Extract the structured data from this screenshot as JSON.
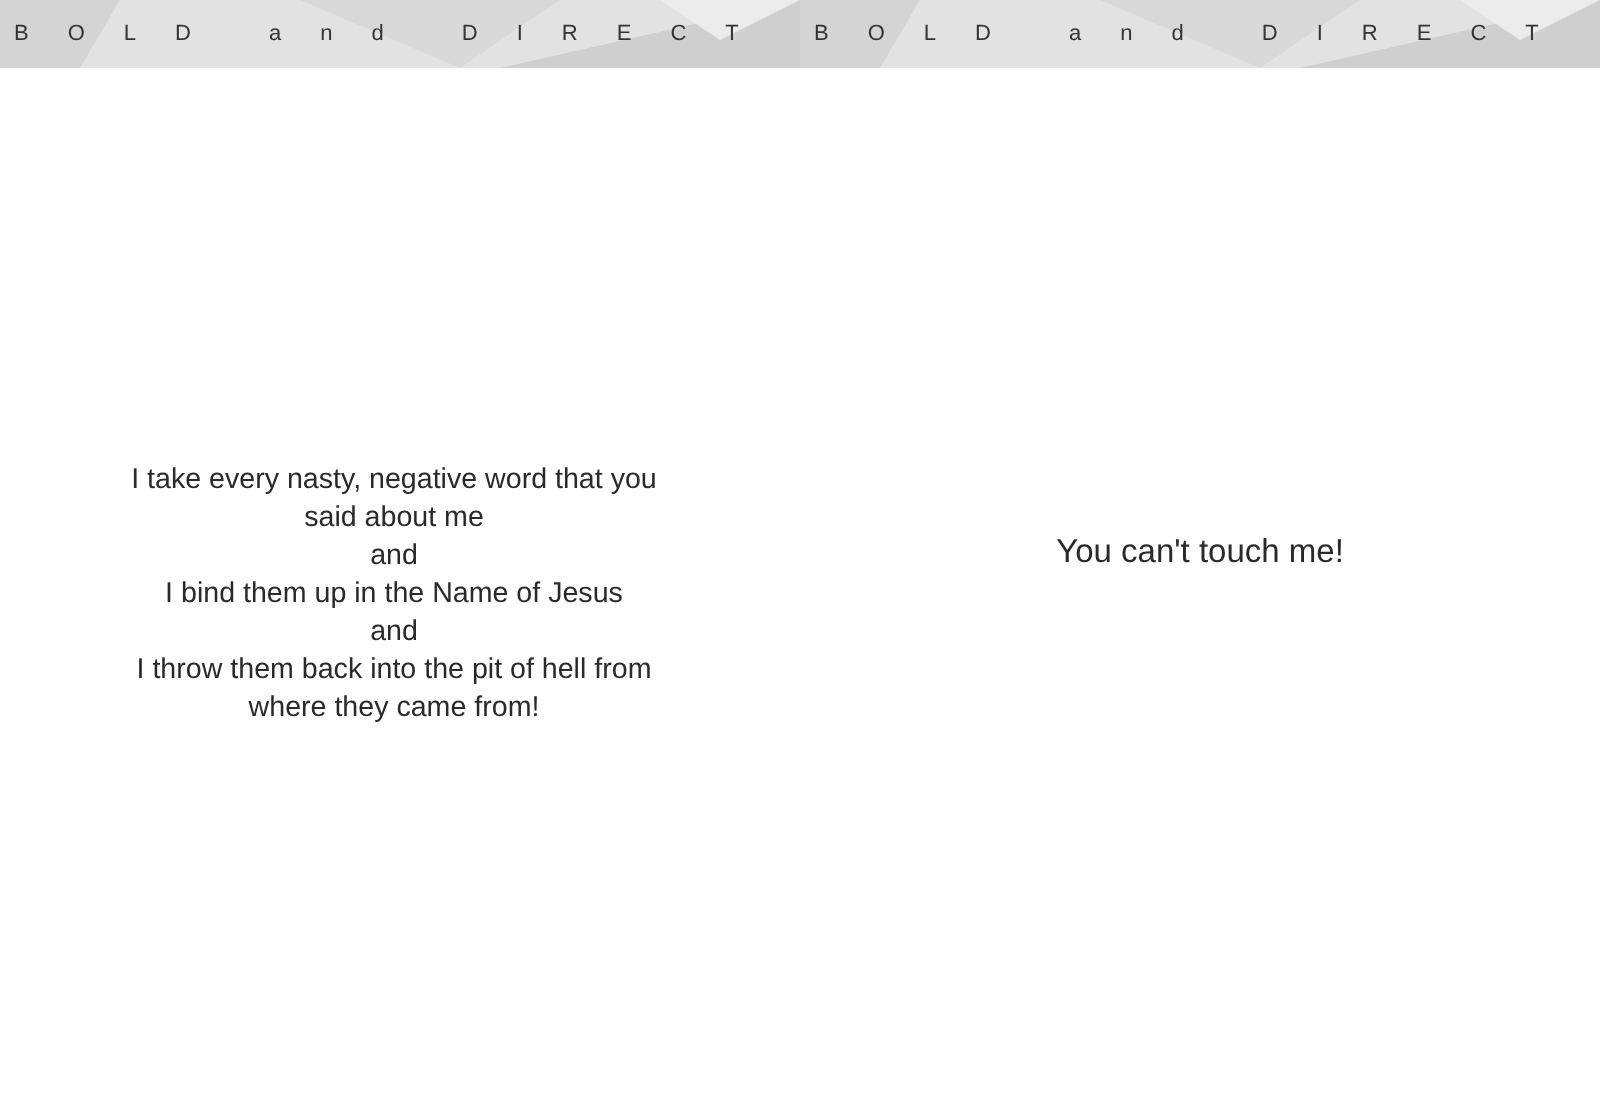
{
  "pages": [
    {
      "header": "BOLD and DIRECT",
      "lines": [
        "I take every nasty, negative word that you",
        "said about me",
        "and",
        "I bind them up in the Name of Jesus",
        "and",
        "I throw them back into the pit of hell from",
        "where they came from!"
      ]
    },
    {
      "header": "BOLD and DIRECT",
      "lines": [
        "You can't touch me!"
      ]
    }
  ]
}
